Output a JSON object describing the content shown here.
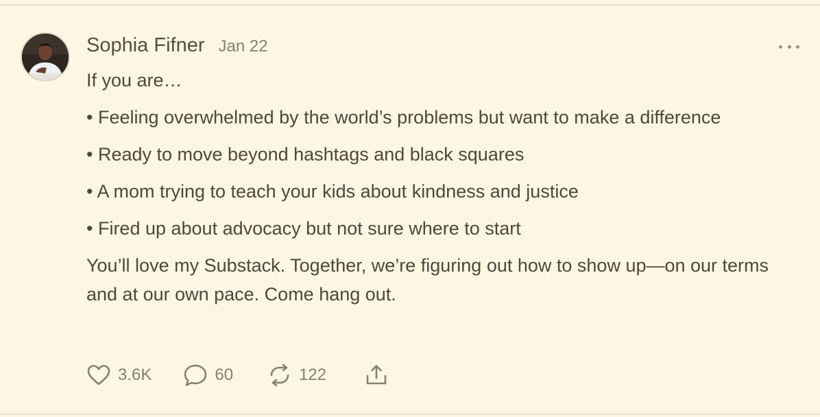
{
  "post": {
    "author": "Sophia Fifner",
    "date": "Jan 22",
    "intro": "If you are…",
    "bullets": [
      "• Feeling overwhelmed by the world’s problems but want to make a difference",
      "• Ready to move beyond hashtags and black squares",
      "• A mom trying to teach your kids about kindness and justice",
      "• Fired up about advocacy but not sure where to start"
    ],
    "outro": "You’ll love my Substack. Together, we’re figuring out how to show up—on our terms and at our own pace. Come hang out."
  },
  "actions": {
    "likes": "3.6K",
    "comments": "60",
    "restacks": "122"
  },
  "icons": {
    "more": "more-horizontal-icon",
    "like": "heart-icon",
    "comment": "comment-bubble-icon",
    "restack": "restack-icon",
    "share": "share-icon"
  },
  "colors": {
    "background": "#fdf6e3",
    "text": "#52463a",
    "muted": "#8a7e6f"
  }
}
